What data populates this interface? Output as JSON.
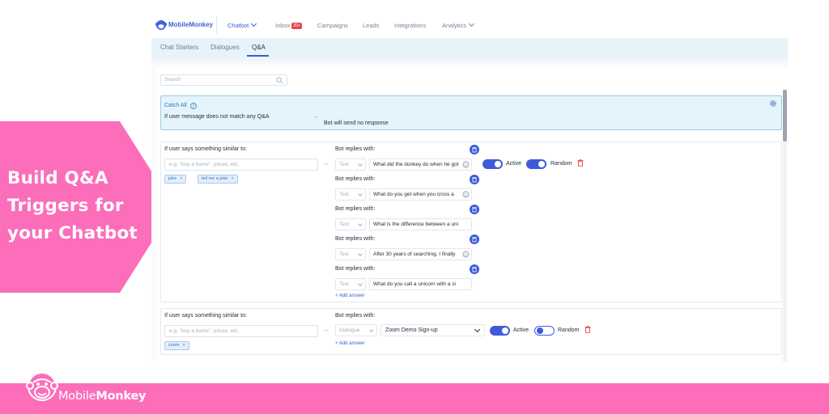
{
  "colors": {
    "brand_pink": "#fc6dba",
    "accent_blue": "#3d5bd9",
    "catchall_bg": "#e5f4fb"
  },
  "promo": {
    "headline": [
      "Build Q&A",
      "Triggers for",
      "your Chatbot"
    ]
  },
  "footer": {
    "brand_prefix": "Mobile",
    "brand_suffix": "Monkey",
    "logo_icon": "monkey-face-icon"
  },
  "app": {
    "logo": {
      "prefix": "Mobile",
      "suffix": "Monkey"
    },
    "nav": [
      {
        "label": "Chatbot"
      },
      {
        "label": "Inbox",
        "badge": "20+"
      },
      {
        "label": "Campaigns"
      },
      {
        "label": "Leads"
      },
      {
        "label": "Integrations"
      },
      {
        "label": "Analytics"
      }
    ],
    "tabs": [
      "Chat Starters",
      "Dialogues",
      "Q&A"
    ],
    "search_placeholder": "Search",
    "catch_all": {
      "title": "Catch All",
      "condition": "If user message does not match any Q&A",
      "arrow": "→",
      "response": "Bot will send no response"
    },
    "qa1": {
      "label": "If user says something similar to:",
      "placeholder": "e.g. \"buy a home\", prices, etc.",
      "tags": [
        "joke",
        "tell me a joke"
      ],
      "replies": [
        {
          "label": "Bot replies with:",
          "type": "Text",
          "text": "What did the donkey do when he got"
        },
        {
          "label": "Bot replies with:",
          "type": "Text",
          "text": "What do you get when you cross a"
        },
        {
          "label": "Bot replies with:",
          "type": "Text",
          "text": "What is the difference between a uni"
        },
        {
          "label": "Bot replies with:",
          "type": "Text",
          "text": "After 30 years of searching, I finally"
        },
        {
          "label": "Bot replies with:",
          "type": "Text",
          "text": "What do you call a unicorn with a si"
        }
      ],
      "active_label": "Active",
      "random_label": "Random",
      "add_answer": "+ Add answer"
    },
    "qa2": {
      "label": "If user says something similar to:",
      "placeholder": "e.g. \"buy a home\", prices, etc.",
      "tags": [
        "zoom"
      ],
      "reply_label": "Bot replies with:",
      "type": "Dialogue",
      "dialogue": "Zoom Demo Sign-up",
      "active_label": "Active",
      "random_label": "Random",
      "add_answer": "+ Add answer"
    }
  }
}
